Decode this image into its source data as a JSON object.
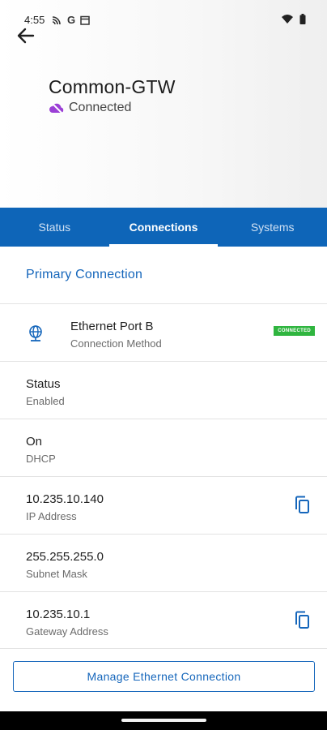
{
  "status_bar": {
    "time": "4:55",
    "g_label": "G"
  },
  "header": {
    "device_name": "Common-GTW",
    "status_text": "Connected",
    "status_color": "#9b3fd6"
  },
  "tabs": [
    {
      "label": "Status"
    },
    {
      "label": "Connections"
    },
    {
      "label": "Systems"
    }
  ],
  "section": {
    "title": "Primary Connection"
  },
  "connection_method": {
    "value": "Ethernet Port B",
    "label": "Connection Method",
    "badge": "CONNECTED",
    "icon": "globe-icon"
  },
  "rows": [
    {
      "value": "Status",
      "label": "Enabled"
    },
    {
      "value": "On",
      "label": "DHCP"
    },
    {
      "value": "10.235.10.140",
      "label": "IP Address",
      "icon": "copy-icon"
    },
    {
      "value": "255.255.255.0",
      "label": "Subnet Mask"
    },
    {
      "value": "10.235.10.1",
      "label": "Gateway Address",
      "icon": "copy-icon"
    }
  ],
  "actions": {
    "manage_label": "Manage Ethernet Connection"
  },
  "colors": {
    "brand_blue": "#0e65b8",
    "link_blue": "#1566bb",
    "badge_green": "#2fb53f"
  }
}
